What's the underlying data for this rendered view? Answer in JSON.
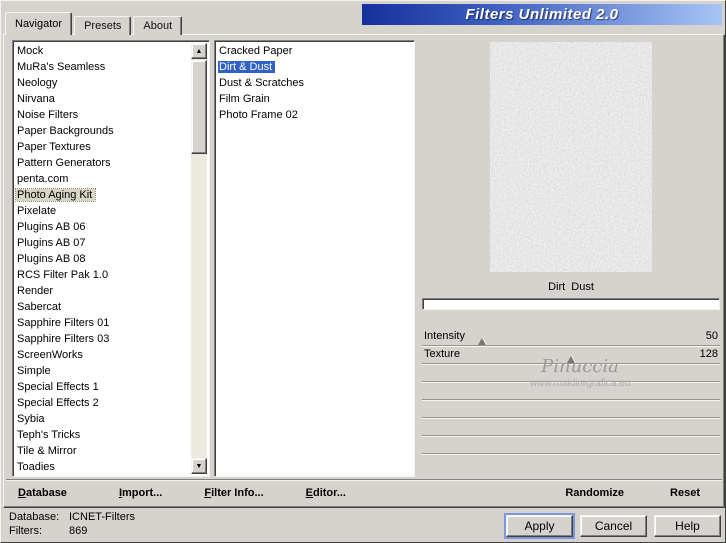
{
  "window": {
    "title": "Filters Unlimited 2.0"
  },
  "tabs": [
    {
      "label": "Navigator",
      "active": true
    },
    {
      "label": "Presets",
      "active": false
    },
    {
      "label": "About",
      "active": false
    }
  ],
  "categories": {
    "selected": "Photo Aging Kit",
    "items": [
      "Mock",
      "MuRa's Seamless",
      "Neology",
      "Nirvana",
      "Noise Filters",
      "Paper Backgrounds",
      "Paper Textures",
      "Pattern Generators",
      "penta.com",
      "Photo Aging Kit",
      "Pixelate",
      "Plugins AB 06",
      "Plugins AB 07",
      "Plugins AB 08",
      "RCS Filter Pak 1.0",
      "Render",
      "Sabercat",
      "Sapphire Filters 01",
      "Sapphire Filters 03",
      "ScreenWorks",
      "Simple",
      "Special Effects 1",
      "Special Effects 2",
      "Sybia",
      "Teph's Tricks",
      "Tile & Mirror",
      "Toadies"
    ]
  },
  "filters": {
    "selected": "Dirt & Dust",
    "items": [
      "Cracked Paper",
      "Dirt & Dust",
      "Dust & Scratches",
      "Film Grain",
      "Photo Frame 02"
    ]
  },
  "preview": {
    "caption": "Dirt  Dust"
  },
  "controls": {
    "sliders": [
      {
        "label": "Intensity",
        "value": "50",
        "percent": 20
      },
      {
        "label": "Texture",
        "value": "128",
        "percent": 50
      }
    ],
    "empty_rows": 5
  },
  "watermark": {
    "name": "Pinuccia",
    "url": "www.maidiregrafica.eu"
  },
  "toolbar": {
    "left": [
      "Database",
      "Import...",
      "Filter Info...",
      "Editor..."
    ],
    "right": [
      "Randomize",
      "Reset"
    ]
  },
  "status": {
    "database_label": "Database:",
    "database_value": "ICNET-Filters",
    "filters_label": "Filters:",
    "filters_value": "869"
  },
  "dialog_buttons": {
    "apply": "Apply",
    "cancel": "Cancel",
    "help": "Help"
  },
  "colors": {
    "selection": "#3161c5",
    "titlebar_start": "#16309c",
    "titlebar_end": "#a8c4f4",
    "window_bg": "#d6d3ce"
  }
}
